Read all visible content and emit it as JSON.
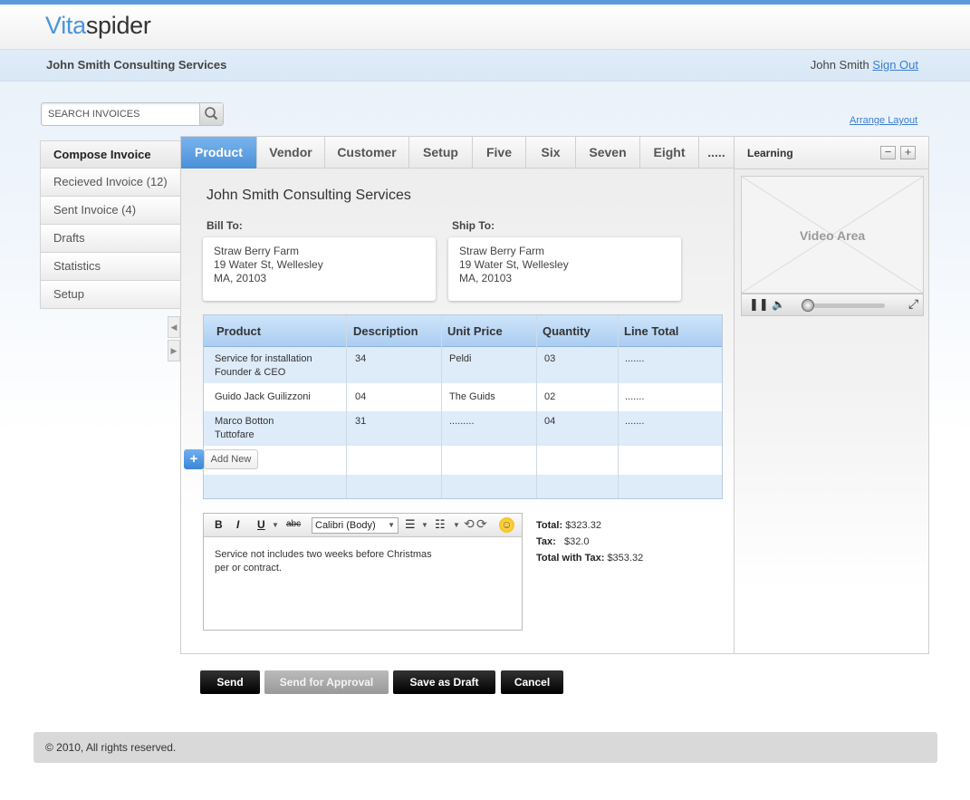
{
  "header": {
    "logo_part1": "Vita",
    "logo_part2": "spider",
    "company": "John Smith Consulting Services",
    "user_name": "John Smith",
    "sign_out": "Sign Out"
  },
  "search": {
    "placeholder": "SEARCH INVOICES",
    "icon": "search-icon"
  },
  "arrange_layout": "Arrange Layout",
  "sidebar": {
    "items": [
      {
        "label": "Compose Invoice",
        "active": true
      },
      {
        "label": "Recieved Invoice (12)"
      },
      {
        "label": "Sent Invoice (4)"
      },
      {
        "label": "Drafts"
      },
      {
        "label": "Statistics"
      },
      {
        "label": "Setup"
      }
    ]
  },
  "tabs": [
    "Product",
    "Vendor",
    "Customer",
    "Setup",
    "Five",
    "Six",
    "Seven",
    "Eight",
    "....."
  ],
  "invoice": {
    "title": "John Smith Consulting Services",
    "bill_to_label": "Bill To:",
    "ship_to_label": "Ship To:",
    "bill_to": [
      "Straw Berry Farm",
      "19 Water St, Wellesley",
      "MA, 20103"
    ],
    "ship_to": [
      "Straw Berry Farm",
      "19 Water St, Wellesley",
      "MA, 20103"
    ]
  },
  "table": {
    "columns": [
      "Product",
      "Description",
      "Unit Price",
      "Quantity",
      "Line Total"
    ],
    "rows": [
      {
        "product_line1": "Service for installation",
        "product_line2": "Founder & CEO",
        "description": "34",
        "unit_price": "Peldi",
        "quantity": "03",
        "line_total": "......."
      },
      {
        "product_line1": "Guido Jack Guilizzoni",
        "product_line2": "",
        "description": "04",
        "unit_price": "The Guids",
        "quantity": "02",
        "line_total": "......."
      },
      {
        "product_line1": "Marco Botton",
        "product_line2": "Tuttofare",
        "description": "31",
        "unit_price": ".........",
        "quantity": "04",
        "line_total": "......."
      }
    ],
    "add_new": "Add New"
  },
  "editor": {
    "bold": "B",
    "italic": "I",
    "underline": "U",
    "strike": "abc",
    "font": "Calibri (Body)",
    "text_line1": "Service not includes two weeks before Christmas",
    "text_line2": "per or contract."
  },
  "totals": {
    "total_label": "Total:",
    "total_value": "$323.32",
    "tax_label": "Tax:",
    "tax_value": "$32.0",
    "total_tax_label": "Total with Tax:",
    "total_tax_value": "$353.32"
  },
  "learning": {
    "title": "Learning",
    "minus": "−",
    "plus": "+",
    "video_label": "Video Area"
  },
  "actions": {
    "send": "Send",
    "send_approval": "Send for Approval",
    "save_draft": "Save as Draft",
    "cancel": "Cancel"
  },
  "footer": "© 2010, All rights reserved.",
  "colors": {
    "accent": "#4a94de",
    "tab_active": "#5a9be0",
    "button": "#000000"
  }
}
